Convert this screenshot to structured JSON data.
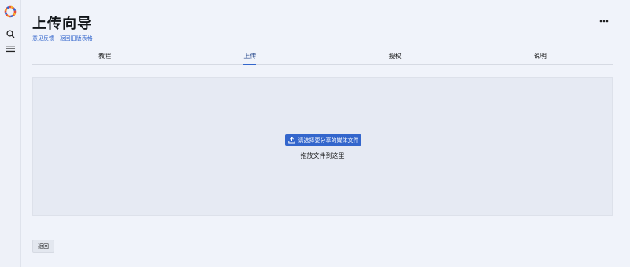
{
  "page": {
    "title": "上传向导",
    "links": {
      "feedback": "意见反馈",
      "separator": " · ",
      "old_form": "返回旧版表格"
    }
  },
  "sidebar": {
    "icons": [
      "logo",
      "search-icon",
      "menu-icon"
    ]
  },
  "header": {
    "more_icon": "more-icon"
  },
  "tabs": [
    {
      "label": "教程",
      "active": false
    },
    {
      "label": "上传",
      "active": true
    },
    {
      "label": "授权",
      "active": false
    },
    {
      "label": "说明",
      "active": false
    }
  ],
  "upload": {
    "button_label": "请选择要分享的媒体文件",
    "drop_text": "拖放文件到这里"
  },
  "footer": {
    "back_label": "返回"
  },
  "colors": {
    "accent": "#3366cc",
    "background": "#f0f3fa",
    "dropzone": "#e6eaf3"
  }
}
